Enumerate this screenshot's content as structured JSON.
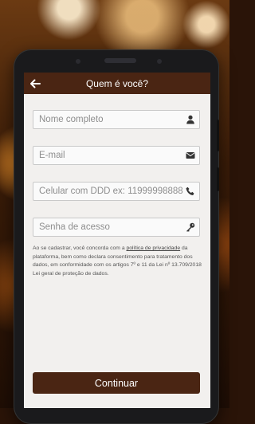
{
  "header": {
    "title": "Quem é você?"
  },
  "form": {
    "name": {
      "placeholder": "Nome completo",
      "icon": "user-icon"
    },
    "email": {
      "placeholder": "E-mail",
      "icon": "envelope-icon"
    },
    "phone": {
      "placeholder": "Celular com DDD ex: 11999998888",
      "icon": "phone-icon"
    },
    "password": {
      "placeholder": "Senha de acesso",
      "icon": "key-icon"
    }
  },
  "terms": {
    "before": "Ao se cadastrar, você concorda com a ",
    "link": "política de privacidade",
    "after": " da plataforma, bem como declara consentimento para tratamento dos dados, em conformidade com os artigos 7º e 11 da Lei nº 13.709/2018 Lei geral de proteção de dados."
  },
  "actions": {
    "continue_label": "Continuar"
  },
  "colors": {
    "primary": "#4a2513",
    "screen_bg": "#f2f0ee"
  }
}
